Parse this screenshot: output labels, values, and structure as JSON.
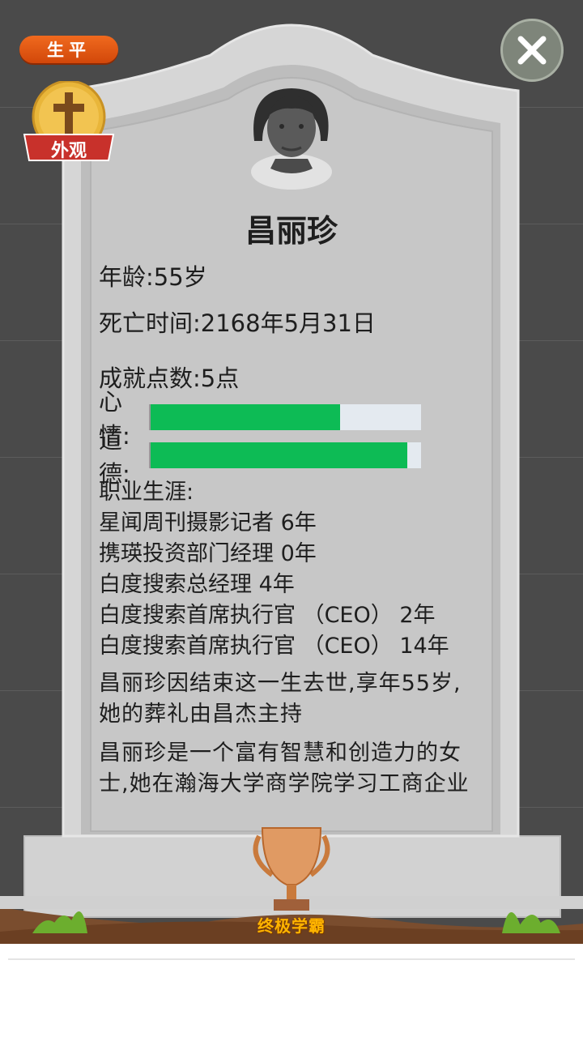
{
  "header": {
    "shengping_label": "生平",
    "appearance_label": "外观"
  },
  "profile": {
    "name": "昌丽珍",
    "age_text": "年龄:55岁",
    "death_time_text": "死亡时间:2168年5月31日",
    "achievement_points_text": "成就点数:5点"
  },
  "stats": {
    "mood_label": "心情:",
    "mood_value": 0.7,
    "morality_label": "道德:",
    "morality_value": 0.95
  },
  "career": {
    "heading": "职业生涯:",
    "items": [
      "星闻周刊摄影记者 6年",
      "携瑛投资部门经理 0年",
      "白度搜索总经理 4年",
      "白度搜索首席执行官 （CEO） 2年",
      "白度搜索首席执行官 （CEO） 14年"
    ]
  },
  "epitaph": {
    "line1": "昌丽珍因结束这一生去世,享年55岁,",
    "line2": "她的葬礼由昌杰主持",
    "line3": "昌丽珍是一个富有智慧和创造力的女",
    "line4": "士,她在瀚海大学商学院学习工商企业"
  },
  "trophy": {
    "title": "终极学霸"
  },
  "colors": {
    "bar_fill": "#0dbb55",
    "bar_track": "#e4eaf0",
    "button_orange": "#e0580f",
    "ribbon_red": "#d23a34",
    "coin_gold": "#e8b83a"
  },
  "icons": {
    "close": "close-icon",
    "cross": "cross-icon",
    "trophy": "trophy-icon",
    "avatar": "female-avatar-icon"
  }
}
